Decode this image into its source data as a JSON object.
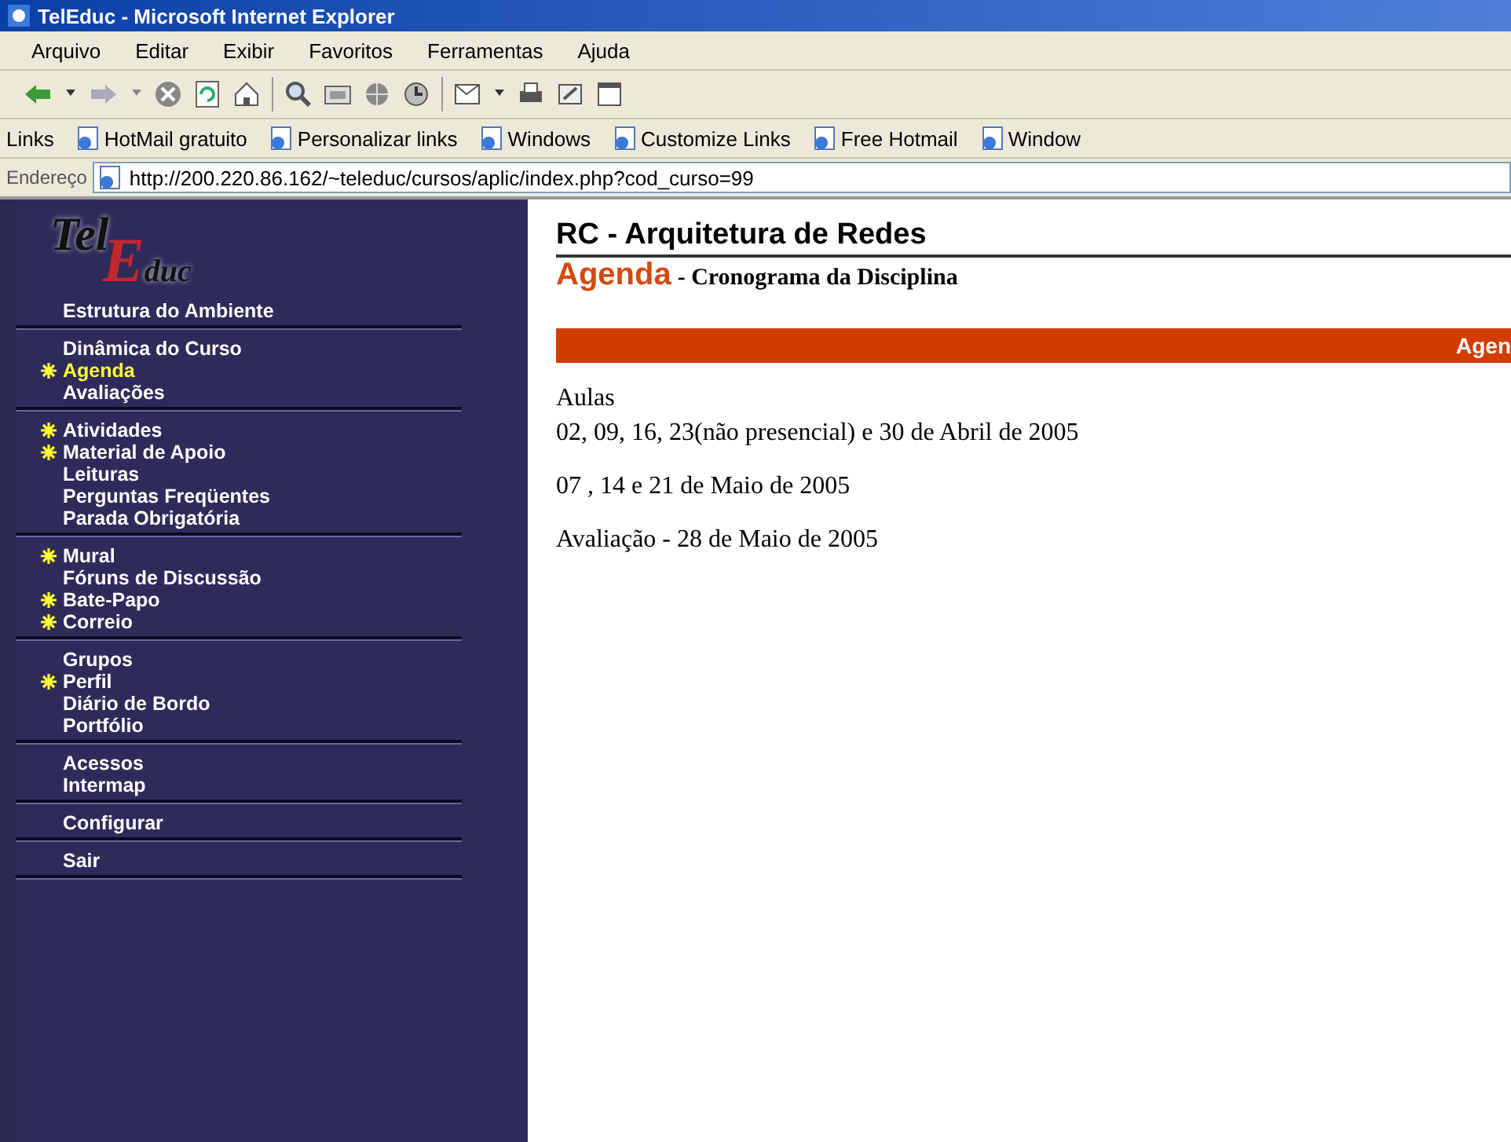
{
  "window": {
    "title": "TelEduc - Microsoft Internet Explorer"
  },
  "menu_bar": [
    "Arquivo",
    "Editar",
    "Exibir",
    "Favoritos",
    "Ferramentas",
    "Ajuda"
  ],
  "links_bar": {
    "label": "Links",
    "links": [
      "HotMail gratuito",
      "Personalizar links",
      "Windows",
      "Customize Links",
      "Free Hotmail",
      "Window"
    ]
  },
  "address_bar": {
    "label": "Endereço",
    "value": "http://200.220.86.162/~teleduc/cursos/aplic/index.php?cod_curso=99"
  },
  "sidebar": {
    "logo": [
      "Tel",
      "E",
      "duc"
    ],
    "groups": [
      [
        {
          "label": "Estrutura do Ambiente",
          "new": false,
          "selected": false
        }
      ],
      [
        {
          "label": "Dinâmica do Curso",
          "new": false,
          "selected": false
        },
        {
          "label": "Agenda",
          "new": true,
          "selected": true
        },
        {
          "label": "Avaliações",
          "new": false,
          "selected": false
        }
      ],
      [
        {
          "label": "Atividades",
          "new": true,
          "selected": false
        },
        {
          "label": "Material de Apoio",
          "new": true,
          "selected": false
        },
        {
          "label": "Leituras",
          "new": false,
          "selected": false
        },
        {
          "label": "Perguntas Freqüentes",
          "new": false,
          "selected": false
        },
        {
          "label": "Parada Obrigatória",
          "new": false,
          "selected": false
        }
      ],
      [
        {
          "label": "Mural",
          "new": true,
          "selected": false
        },
        {
          "label": "Fóruns de Discussão",
          "new": false,
          "selected": false
        },
        {
          "label": "Bate-Papo",
          "new": true,
          "selected": false
        },
        {
          "label": "Correio",
          "new": true,
          "selected": false
        }
      ],
      [
        {
          "label": "Grupos",
          "new": false,
          "selected": false
        },
        {
          "label": "Perfil",
          "new": true,
          "selected": false
        },
        {
          "label": "Diário de Bordo",
          "new": false,
          "selected": false
        },
        {
          "label": "Portfólio",
          "new": false,
          "selected": false
        }
      ],
      [
        {
          "label": "Acessos",
          "new": false,
          "selected": false
        },
        {
          "label": "Intermap",
          "new": false,
          "selected": false
        }
      ],
      [
        {
          "label": "Configurar",
          "new": false,
          "selected": false
        }
      ],
      [
        {
          "label": "Sair",
          "new": false,
          "selected": false
        }
      ]
    ]
  },
  "content": {
    "course_title": "RC - Arquitetura de Redes",
    "tool_name": "Agenda",
    "subtitle": "- Cronograma da Disciplina",
    "bar_label": "Agen",
    "paragraphs": [
      [
        "Aulas",
        "02, 09, 16, 23(não presencial) e 30 de Abril de 2005"
      ],
      [
        "07 , 14 e 21 de Maio de 2005"
      ],
      [
        "Avaliação - 28 de Maio de 2005"
      ]
    ]
  }
}
